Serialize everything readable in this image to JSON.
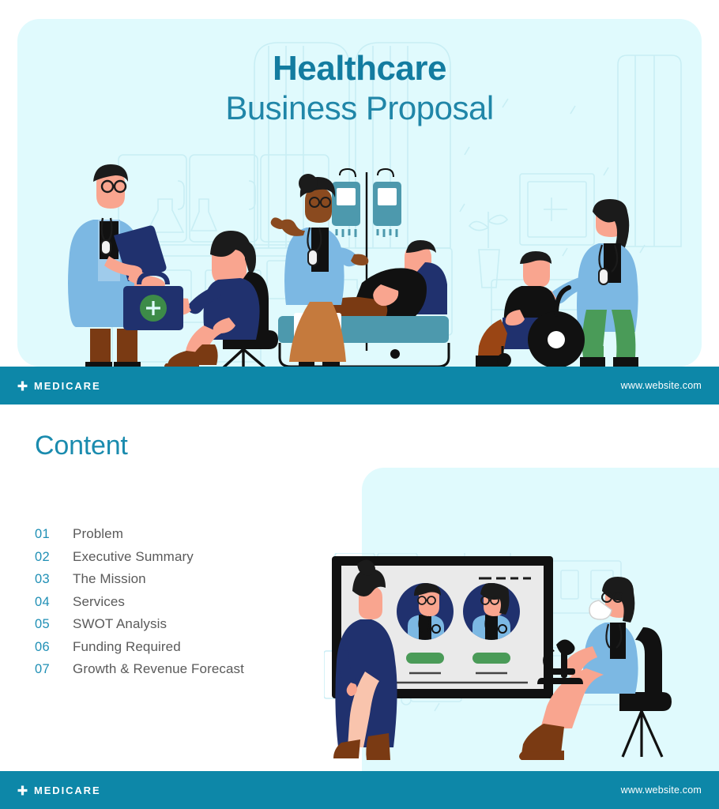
{
  "hero": {
    "title_line1": "Healthcare",
    "title_line2": "Business Proposal",
    "bg_color": "#e0fafd",
    "title_color_1": "#137ca0",
    "title_color_2": "#2086a8"
  },
  "footer_top": {
    "brand_icon": "medical-cross-icon",
    "brand_label": "MEDICARE",
    "url": "www.website.com",
    "bg_color": "#0d87a8"
  },
  "footer_bottom": {
    "brand_icon": "medical-cross-icon",
    "brand_label": "MEDICARE",
    "url": "www.website.com",
    "bg_color": "#0d87a8"
  },
  "content": {
    "heading": "Content",
    "heading_color": "#1a8bae",
    "number_color": "#1f8fb5",
    "label_color": "#5a5a5a",
    "items": [
      {
        "number": "01",
        "label": "Problem"
      },
      {
        "number": "02",
        "label": "Executive Summary"
      },
      {
        "number": "03",
        "label": "The Mission"
      },
      {
        "number": "04",
        "label": "Services"
      },
      {
        "number": "05",
        "label": "SWOT Analysis"
      },
      {
        "number": "06",
        "label": "Funding Required"
      },
      {
        "number": "07",
        "label": "Growth & Revenue Forecast"
      }
    ]
  },
  "illustrations": {
    "hero_scene": "hospital-scene-illustration",
    "bottom_scene": "medical-presentation-illustration"
  }
}
